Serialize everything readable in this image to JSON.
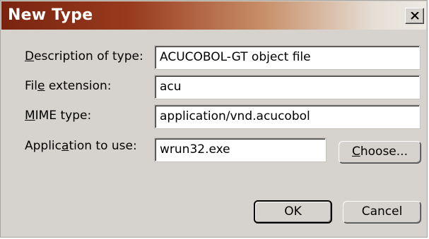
{
  "window": {
    "title": "New Type",
    "close_icon": "close-icon"
  },
  "fields": {
    "description": {
      "label_pre": "",
      "label_key": "D",
      "label_post": "escription of type:",
      "value": "ACUCOBOL-GT object file"
    },
    "extension": {
      "label_pre": "Fil",
      "label_key": "e",
      "label_post": " extension:",
      "value": "acu"
    },
    "mime": {
      "label_pre": "",
      "label_key": "M",
      "label_post": "IME type:",
      "value": "application/vnd.acucobol"
    },
    "application": {
      "label_pre": "Applic",
      "label_key": "a",
      "label_post": "tion to use:",
      "value": "wrun32.exe"
    }
  },
  "buttons": {
    "choose": {
      "pre": "",
      "key": "C",
      "post": "hoose..."
    },
    "ok": {
      "label": "OK"
    },
    "cancel": {
      "label": "Cancel"
    }
  },
  "colors": {
    "title_start": "#7a2410",
    "title_end": "#ece9e3",
    "dialog_bg": "#d6d3ce"
  }
}
